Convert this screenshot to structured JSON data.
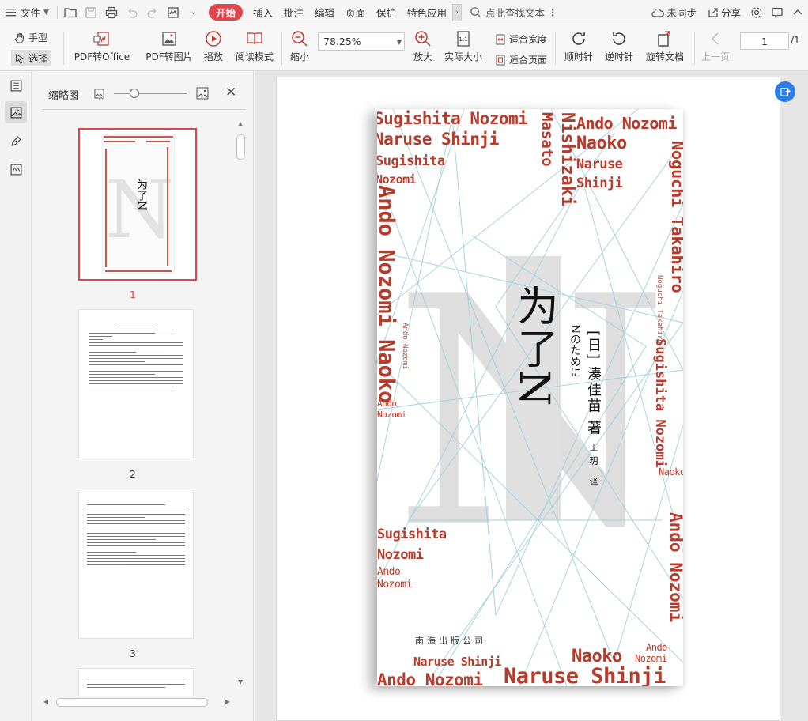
{
  "menu": {
    "file": "文件",
    "tabs": [
      "开始",
      "插入",
      "批注",
      "编辑",
      "页面",
      "保护",
      "特色应用"
    ],
    "active_tab": "开始",
    "search_placeholder": "点此查找文本",
    "sync": "未同步",
    "share": "分享"
  },
  "ribbon": {
    "hand": "手型",
    "select": "选择",
    "pdf_to_office": "PDF转Office",
    "pdf_to_image": "PDF转图片",
    "play": "播放",
    "read_mode": "阅读模式",
    "zoom_out": "缩小",
    "zoom_value": "78.25%",
    "zoom_in": "放大",
    "actual_size": "实际大小",
    "fit_width": "适合宽度",
    "fit_page": "适合页面",
    "rotate_cw": "顺时针",
    "rotate_ccw": "逆时针",
    "rotate_doc": "旋转文档",
    "prev_page": "上一页",
    "current_page": "1",
    "total_pages": "/1"
  },
  "thumbnails": {
    "title": "缩略图",
    "pages": [
      "1",
      "2",
      "3"
    ]
  },
  "cover": {
    "title": "为了N",
    "subtitle": "Nのために",
    "author": "[日] 湊佳苗 著",
    "translator": "王玥 译",
    "publisher": "南海出版公司",
    "names": {
      "sugishita_nozomi": "Sugishita Nozomi",
      "naruse_shinji": "Naruse Shinji",
      "ando_nozomi": "Ando Nozomi",
      "naoko": "Naoko",
      "nishizaki_masato": "Nishizaki",
      "masato": "Masato",
      "noguchi_takahiro": "Noguchi Takahiro",
      "sugishita": "Sugishita",
      "nozomi": "Nozomi",
      "ando": "Ando",
      "naruse": "Naruse",
      "shinji": "Shinji",
      "ando_nozomi_naoko": "Ando Nozomi Naoko",
      "noguchi_takahiro_small": "Noguchi Takahiro",
      "ando_nozomi_small": "Ando Nozomi"
    }
  },
  "colors": {
    "accent": "#e0454b",
    "cover_red": "#b83a2a",
    "line_blue": "#9fd0dc",
    "float_btn": "#2b7de9"
  }
}
